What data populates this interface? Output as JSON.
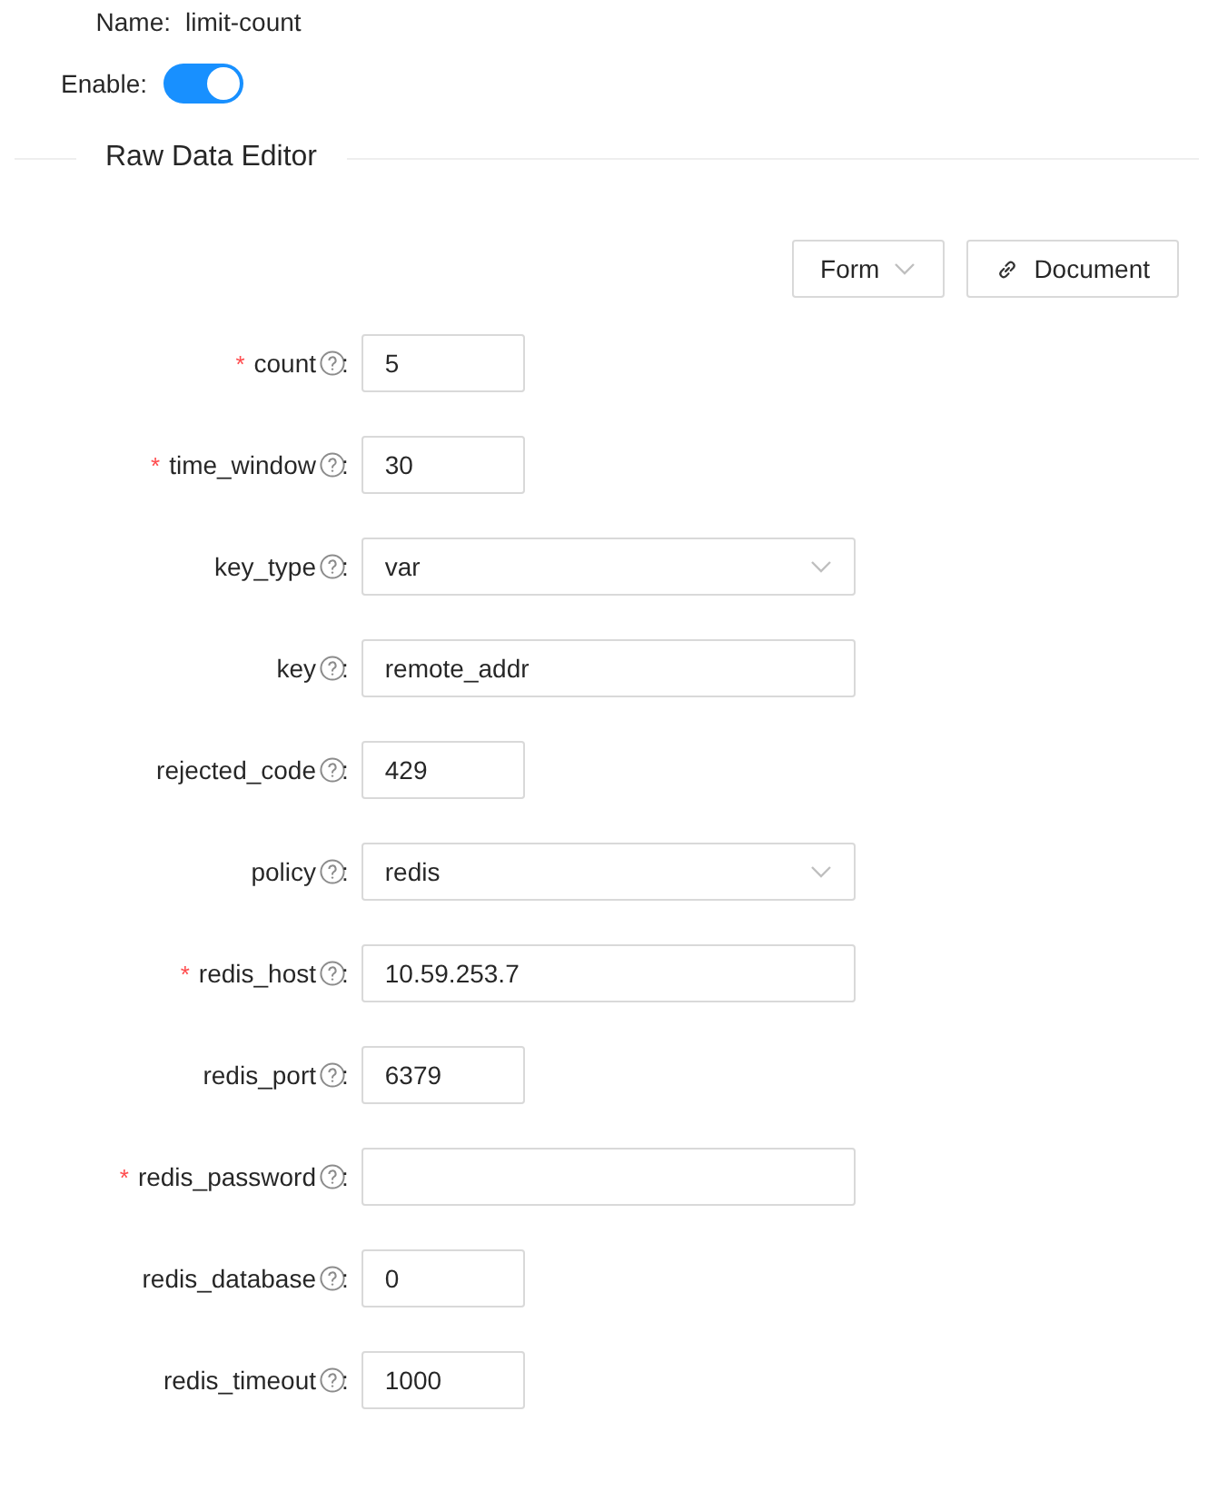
{
  "name": {
    "label": "Name:",
    "value": "limit-count"
  },
  "enable": {
    "label": "Enable:",
    "on": true
  },
  "section_title": "Raw Data Editor",
  "toolbar": {
    "mode": "Form",
    "document": "Document"
  },
  "fields": [
    {
      "label": "count",
      "colon": ":",
      "required_mark": "*",
      "kind": "short",
      "value": "5"
    },
    {
      "label": "time_window",
      "colon": ":",
      "required_mark": "*",
      "kind": "short",
      "value": "30"
    },
    {
      "label": "key_type",
      "colon": ":",
      "kind": "select",
      "value": "var"
    },
    {
      "label": "key",
      "colon": ":",
      "kind": "long",
      "value": "remote_addr"
    },
    {
      "label": "rejected_code",
      "colon": ":",
      "kind": "short",
      "value": "429"
    },
    {
      "label": "policy",
      "colon": ":",
      "kind": "select",
      "value": "redis"
    },
    {
      "label": "redis_host",
      "colon": ":",
      "required_mark": "*",
      "kind": "long",
      "value": "10.59.253.7"
    },
    {
      "label": "redis_port",
      "colon": ":",
      "kind": "short",
      "value": "6379"
    },
    {
      "label": "redis_password",
      "colon": ":",
      "required_mark": "*",
      "kind": "long"
    },
    {
      "label": "redis_database",
      "colon": ":",
      "kind": "short",
      "value": "0"
    },
    {
      "label": "redis_timeout",
      "colon": ":",
      "kind": "short",
      "value": "1000"
    }
  ]
}
